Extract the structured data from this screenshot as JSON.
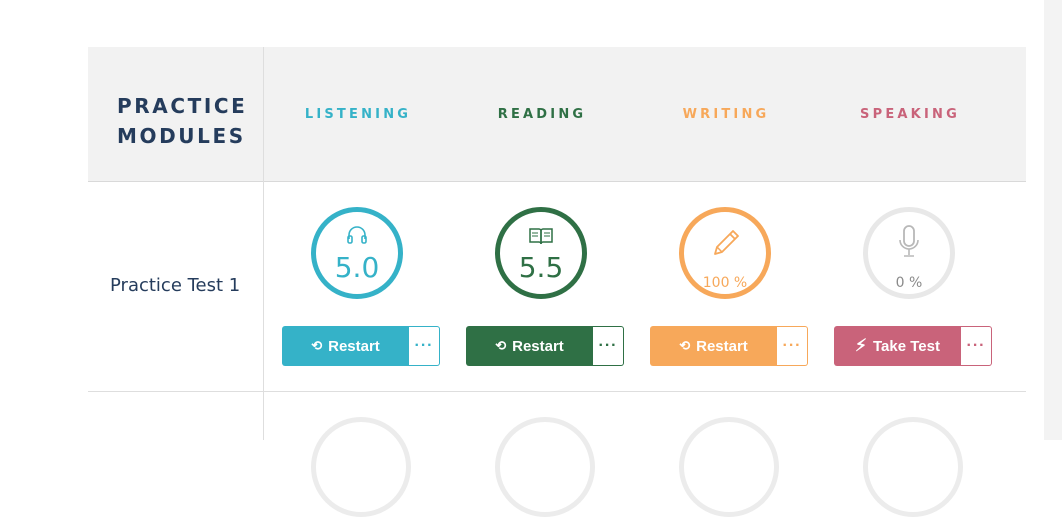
{
  "header": {
    "modules_title_line1": "PRACTICE",
    "modules_title_line2": "MODULES",
    "columns": [
      {
        "key": "listening",
        "label": "LISTENING",
        "color": "#35b2c8"
      },
      {
        "key": "reading",
        "label": "READING",
        "color": "#2f7045"
      },
      {
        "key": "writing",
        "label": "WRITING",
        "color": "#f7a85a"
      },
      {
        "key": "speaking",
        "label": "SPEAKING",
        "color": "#c9637a"
      }
    ]
  },
  "rows": [
    {
      "label": "Practice Test 1",
      "cells": [
        {
          "icon": "headphones-icon",
          "score": "5.0",
          "progress": null,
          "action": "Restart",
          "action_icon": "restart-icon",
          "ring_color": "#35b2c8"
        },
        {
          "icon": "book-icon",
          "score": "5.5",
          "progress": null,
          "action": "Restart",
          "action_icon": "restart-icon",
          "ring_color": "#2f7045"
        },
        {
          "icon": "pencil-icon",
          "score": null,
          "progress": "100 %",
          "action": "Restart",
          "action_icon": "restart-icon",
          "ring_color": "#f7a85a"
        },
        {
          "icon": "microphone-icon",
          "score": null,
          "progress": "0 %",
          "action": "Take Test",
          "action_icon": "lightning-icon",
          "ring_color": "#e8e8e8"
        }
      ]
    }
  ],
  "more_label": "···"
}
